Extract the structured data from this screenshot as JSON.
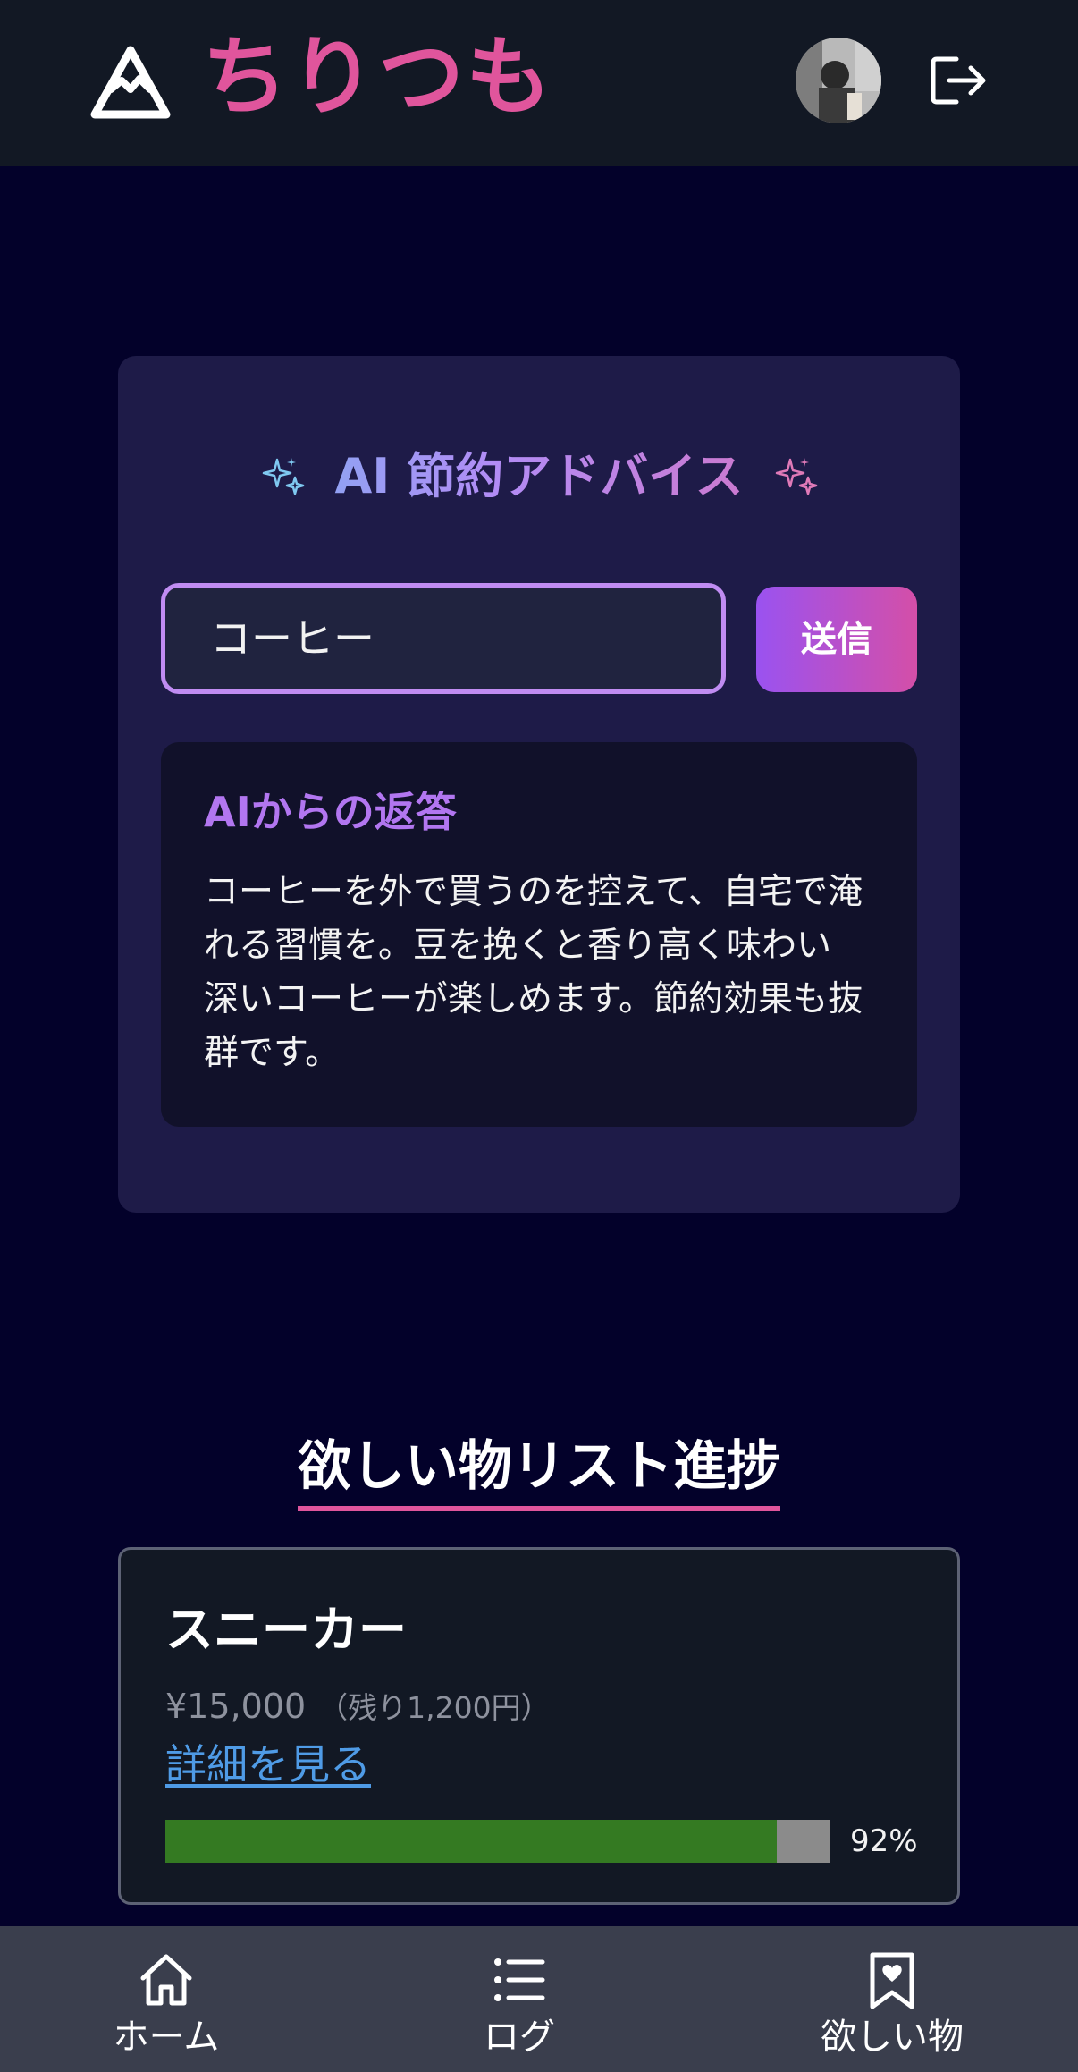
{
  "app": {
    "title": "ちりつも"
  },
  "ai_advice": {
    "title": "AI 節約アドバイス",
    "input_value": "コーヒー",
    "send_label": "送信",
    "response_label": "AIからの返答",
    "response_text": "コーヒーを外で買うのを控えて、自宅で淹れる習慣を。豆を挽くと香り高く味わい深いコーヒーが楽しめます。節約効果も抜群です。"
  },
  "wishlist": {
    "heading": "欲しい物リスト進捗",
    "items": [
      {
        "name": "スニーカー",
        "price": "¥15,000",
        "remaining": "（残り1,200円）",
        "link_label": "詳細を見る",
        "progress": 92,
        "progress_label": "92%"
      }
    ]
  },
  "bottom_nav": {
    "items": [
      {
        "label": "ホーム",
        "icon": "home-icon"
      },
      {
        "label": "ログ",
        "icon": "list-icon"
      },
      {
        "label": "欲しい物",
        "icon": "bookmark-heart-icon"
      }
    ]
  },
  "colors": {
    "brand_pink": "#e0559c",
    "accent_purple": "#b276f0",
    "progress_green": "#347a22"
  }
}
